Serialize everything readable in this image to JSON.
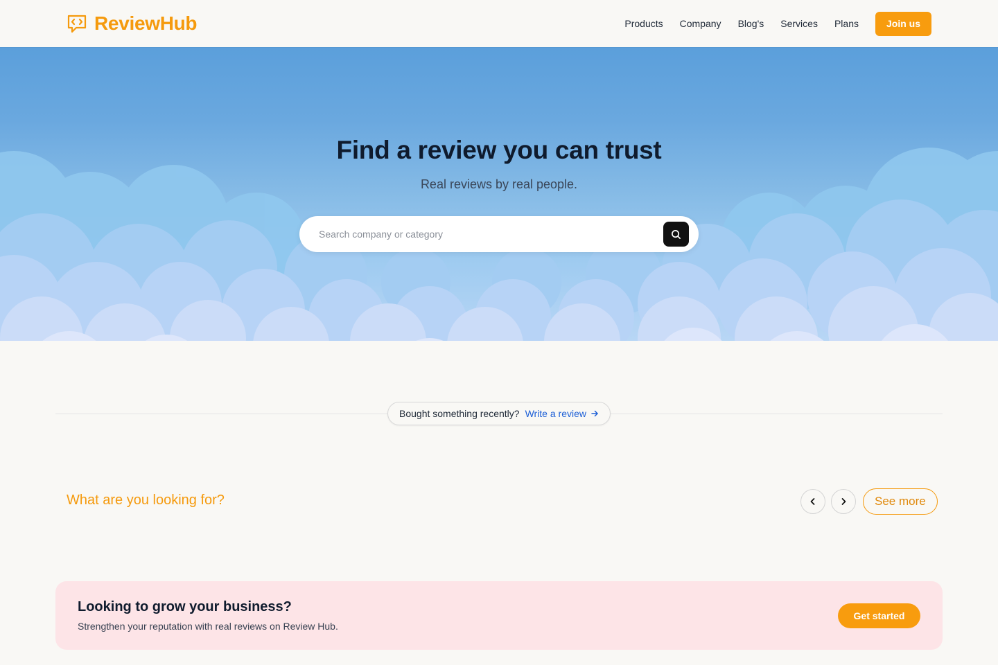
{
  "brand": {
    "name": "ReviewHub",
    "accent": "#f89c0e",
    "logo_icon": "chat-code-icon"
  },
  "nav": {
    "items": [
      {
        "label": "Products"
      },
      {
        "label": "Company"
      },
      {
        "label": "Blog's"
      },
      {
        "label": "Services"
      },
      {
        "label": "Plans"
      }
    ],
    "join_label": "Join us"
  },
  "hero": {
    "title": "Find a review you can trust",
    "subtitle": "Real reviews by real people.",
    "search_placeholder": "Search company or category",
    "search_icon": "search-icon"
  },
  "cta_pill": {
    "text": "Bought something recently?",
    "link_label": "Write a review",
    "link_icon": "arrow-right-icon",
    "link_color": "#1d5fd6"
  },
  "categories": {
    "title": "What are you looking for?",
    "prev_icon": "chevron-left-icon",
    "next_icon": "chevron-right-icon",
    "see_more_label": "See more"
  },
  "banner": {
    "title": "Looking to grow your business?",
    "subtitle": "Strengthen your reputation with real reviews on Review Hub.",
    "button_label": "Get started",
    "background": "#fde4e7"
  }
}
